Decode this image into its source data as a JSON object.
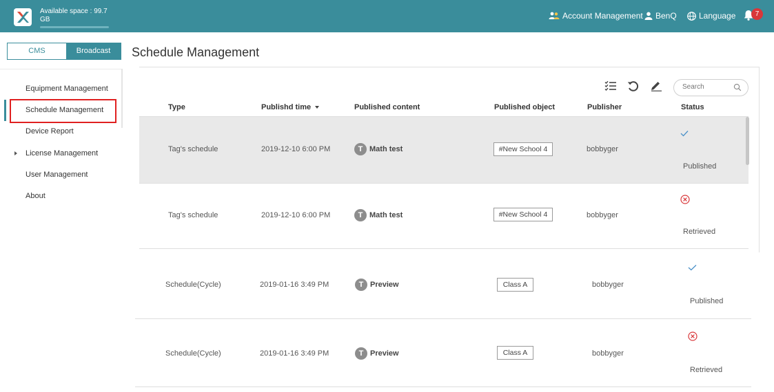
{
  "header": {
    "available_space": "Available space : 99.7 GB",
    "account_management": "Account Management",
    "user": "BenQ",
    "language": "Language",
    "notification_count": "7"
  },
  "toggle": {
    "cms": "CMS",
    "broadcast": "Broadcast"
  },
  "page_title": "Schedule Management",
  "sidebar": {
    "items": [
      {
        "label": "Equipment Management"
      },
      {
        "label": "Schedule Management"
      },
      {
        "label": "Device Report"
      },
      {
        "label": "License Management"
      },
      {
        "label": "User Management"
      },
      {
        "label": "About"
      }
    ]
  },
  "search": {
    "placeholder": "Search"
  },
  "table": {
    "columns": {
      "type": "Type",
      "publish_time": "Publishd time",
      "content": "Published content",
      "object": "Published object",
      "publisher": "Publisher",
      "status": "Status"
    },
    "rows": [
      {
        "type": "Tag's schedule",
        "time": "2019-12-10 6:00 PM",
        "content": "Math test",
        "object": "#New School 4",
        "publisher": "bobbyger",
        "status": "Published"
      },
      {
        "type": "Tag's schedule",
        "time": "2019-12-10 6:00 PM",
        "content": "Math test",
        "object": "#New School 4",
        "publisher": "bobbyger",
        "status": "Retrieved"
      },
      {
        "type": "Schedule(Cycle)",
        "time": "2019-01-16 3:49 PM",
        "content": "Preview",
        "object": "Class A",
        "publisher": "bobbyger",
        "status": "Published"
      },
      {
        "type": "Schedule(Cycle)",
        "time": "2019-01-16 3:49 PM",
        "content": "Preview",
        "object": "Class A",
        "publisher": "bobbyger",
        "status": "Retrieved"
      }
    ],
    "content_icon_letter": "T"
  },
  "colors": {
    "brand": "#3a8d9b",
    "published_check": "#4a90c8",
    "retrieved": "#d9373a",
    "highlight_row": "#e9e9e9",
    "active_box": "#e02020"
  }
}
